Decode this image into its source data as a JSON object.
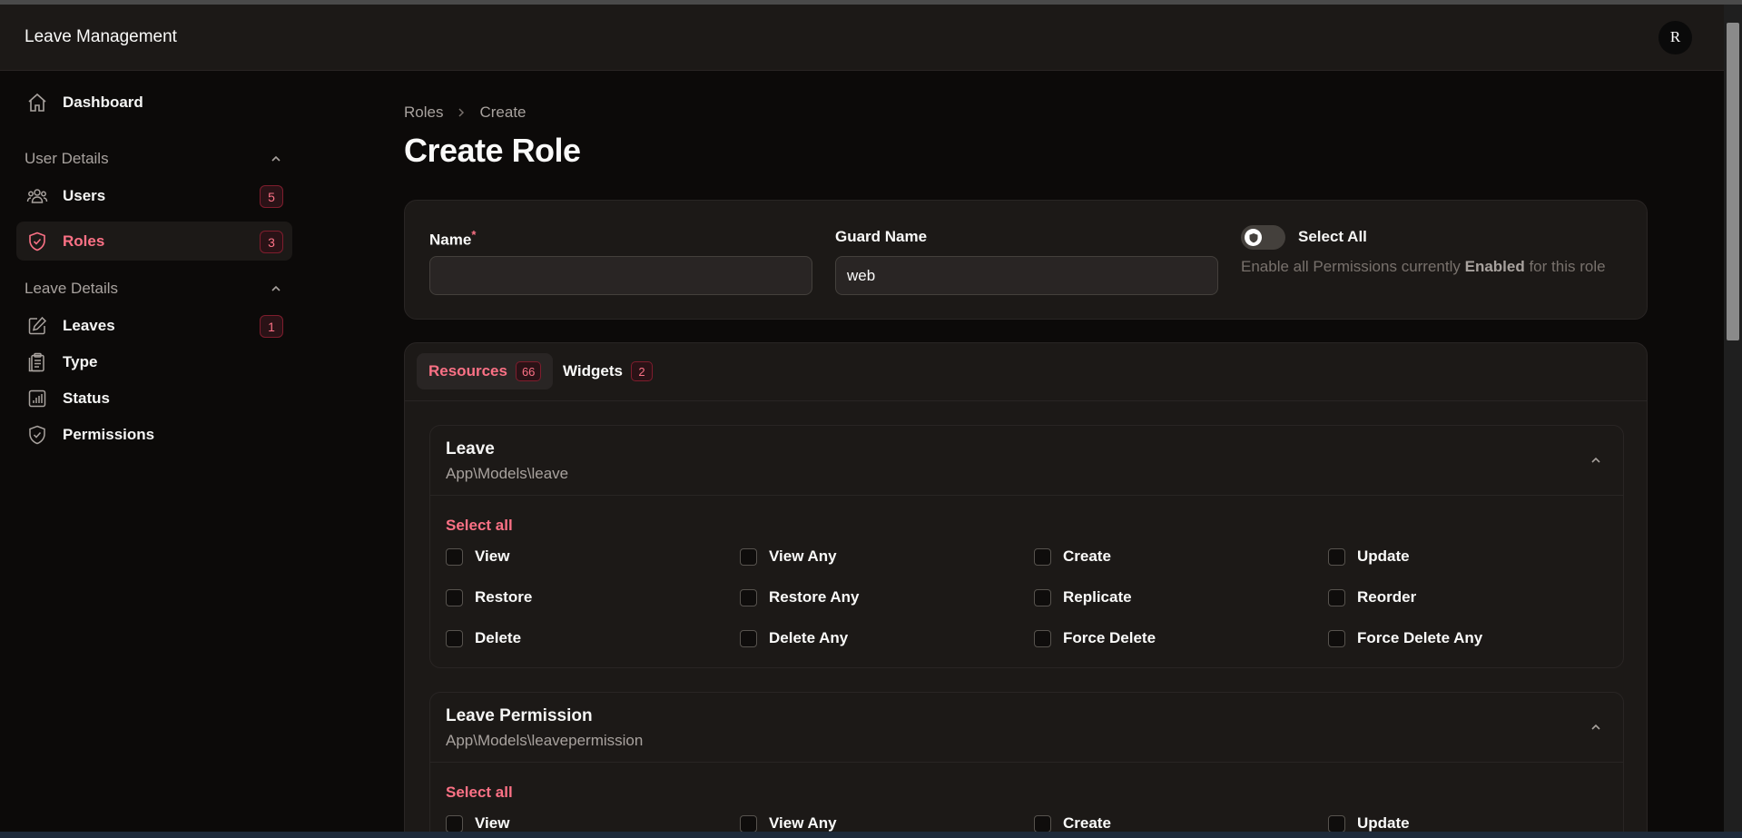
{
  "app": {
    "title": "Leave Management",
    "avatar_initial": "R"
  },
  "sidebar": {
    "dashboard": {
      "label": "Dashboard",
      "icon": "home-icon"
    },
    "groups": [
      {
        "label": "User Details",
        "items": [
          {
            "label": "Users",
            "badge": "5",
            "icon": "users-icon"
          },
          {
            "label": "Roles",
            "badge": "3",
            "icon": "shield-icon",
            "active": true
          }
        ]
      },
      {
        "label": "Leave Details",
        "items": [
          {
            "label": "Leaves",
            "badge": "1",
            "icon": "pencil-square-icon"
          },
          {
            "label": "Type",
            "icon": "clipboard-icon"
          },
          {
            "label": "Status",
            "icon": "chart-bar-icon"
          },
          {
            "label": "Permissions",
            "icon": "shield-check-icon"
          }
        ]
      }
    ]
  },
  "breadcrumb": {
    "parent": "Roles",
    "current": "Create"
  },
  "page": {
    "title": "Create Role"
  },
  "form": {
    "name_label": "Name",
    "name_required_mark": "*",
    "name_value": "",
    "guard_label": "Guard Name",
    "guard_value": "web",
    "select_all_label": "Select All",
    "select_all_help_prefix": "Enable all Permissions currently ",
    "select_all_help_bold": "Enabled",
    "select_all_help_suffix": " for this role"
  },
  "tabs": [
    {
      "label": "Resources",
      "count": "66",
      "active": true
    },
    {
      "label": "Widgets",
      "count": "2",
      "active": false
    }
  ],
  "sections": [
    {
      "title": "Leave",
      "model": "App\\Models\\leave",
      "select_all": "Select all",
      "permissions": [
        "View",
        "View Any",
        "Create",
        "Update",
        "Restore",
        "Restore Any",
        "Replicate",
        "Reorder",
        "Delete",
        "Delete Any",
        "Force Delete",
        "Force Delete Any"
      ]
    },
    {
      "title": "Leave Permission",
      "model": "App\\Models\\leavepermission",
      "select_all": "Select all",
      "permissions": [
        "View",
        "View Any",
        "Create",
        "Update"
      ]
    }
  ],
  "colors": {
    "accent": "#fb7185",
    "background": "#0c0a09",
    "surface": "#1c1917"
  }
}
